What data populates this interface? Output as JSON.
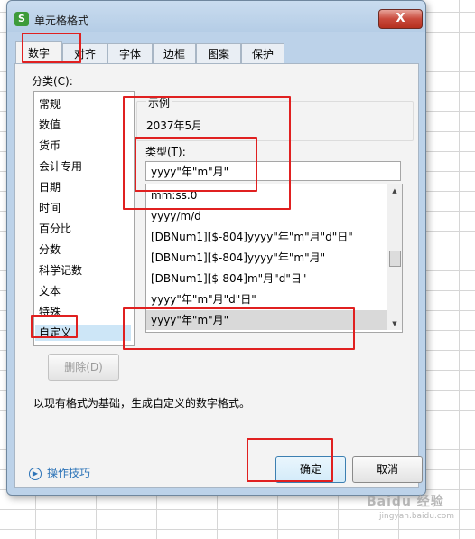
{
  "dialog": {
    "title": "单元格格式",
    "app_icon_glyph": "S",
    "close_glyph": "X",
    "tabs": [
      {
        "label": "数字"
      },
      {
        "label": "对齐"
      },
      {
        "label": "字体"
      },
      {
        "label": "边框"
      },
      {
        "label": "图案"
      },
      {
        "label": "保护"
      }
    ],
    "category_label": "分类(C):",
    "categories": [
      "常规",
      "数值",
      "货币",
      "会计专用",
      "日期",
      "时间",
      "百分比",
      "分数",
      "科学记数",
      "文本",
      "特殊",
      "自定义"
    ],
    "selected_category": "自定义",
    "sample_label": "示例",
    "sample_value": "2037年5月",
    "type_label": "类型(T):",
    "type_value": "yyyy\"年\"m\"月\"",
    "format_list": [
      "mm:ss.0",
      "yyyy/m/d",
      "[DBNum1][$-804]yyyy\"年\"m\"月\"d\"日\"",
      "[DBNum1][$-804]yyyy\"年\"m\"月\"",
      "[DBNum1][$-804]m\"月\"d\"日\"",
      "yyyy\"年\"m\"月\"d\"日\"",
      "yyyy\"年\"m\"月\""
    ],
    "selected_format": "yyyy\"年\"m\"月\"",
    "delete_label": "删除(D)",
    "description": "以现有格式为基础，生成自定义的数字格式。",
    "tips_label": "操作技巧",
    "ok_label": "确定",
    "cancel_label": "取消"
  },
  "watermark": {
    "text": "Baidu 经验",
    "sub": "jingyan.baidu.com"
  },
  "colors": {
    "highlight_box": "#e02020",
    "dialog_frame": "#bcd2e9",
    "link": "#2d74b8"
  }
}
